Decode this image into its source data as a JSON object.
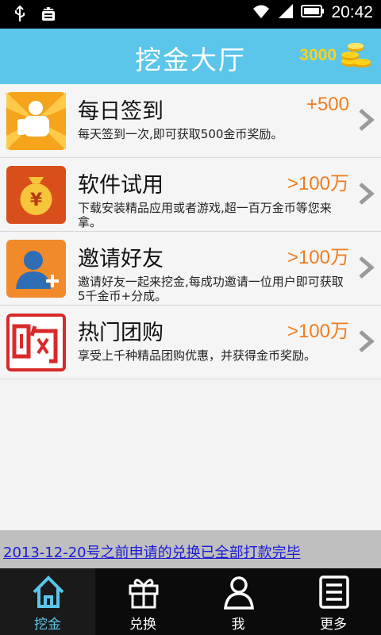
{
  "status_bar": {
    "time": "20:42"
  },
  "header": {
    "title": "挖金大厅",
    "coins": "3000"
  },
  "items": [
    {
      "title": "每日签到",
      "reward": "+500",
      "desc": "每天签到一次,即可获取500金币奖励。",
      "icon": "thumbs-up-icon"
    },
    {
      "title": "软件试用",
      "reward": ">100万",
      "desc": "下载安装精品应用或者游戏,超一百万金币等您来拿。",
      "icon": "money-bag-icon"
    },
    {
      "title": "邀请好友",
      "reward": ">100万",
      "desc": "邀请好友一起来挖金,每成功邀请一位用户即可获取5千金币+分成。",
      "icon": "add-user-icon"
    },
    {
      "title": "热门团购",
      "reward": ">100万",
      "desc": "享受上千种精品团购优惠，并获得金币奖励。",
      "icon": "group-buy-icon"
    }
  ],
  "notice": "2013-12-20号之前申请的兑换已全部打款完毕",
  "tabs": [
    {
      "label": "挖金",
      "icon": "home-icon",
      "active": true
    },
    {
      "label": "兑换",
      "icon": "gift-icon",
      "active": false
    },
    {
      "label": "我",
      "icon": "user-icon",
      "active": false
    },
    {
      "label": "更多",
      "icon": "list-icon",
      "active": false
    }
  ],
  "colors": {
    "header": "#5bc6ea",
    "reward": "#f07d1e",
    "coins": "#ffd21a",
    "link": "#1a1ad8"
  }
}
